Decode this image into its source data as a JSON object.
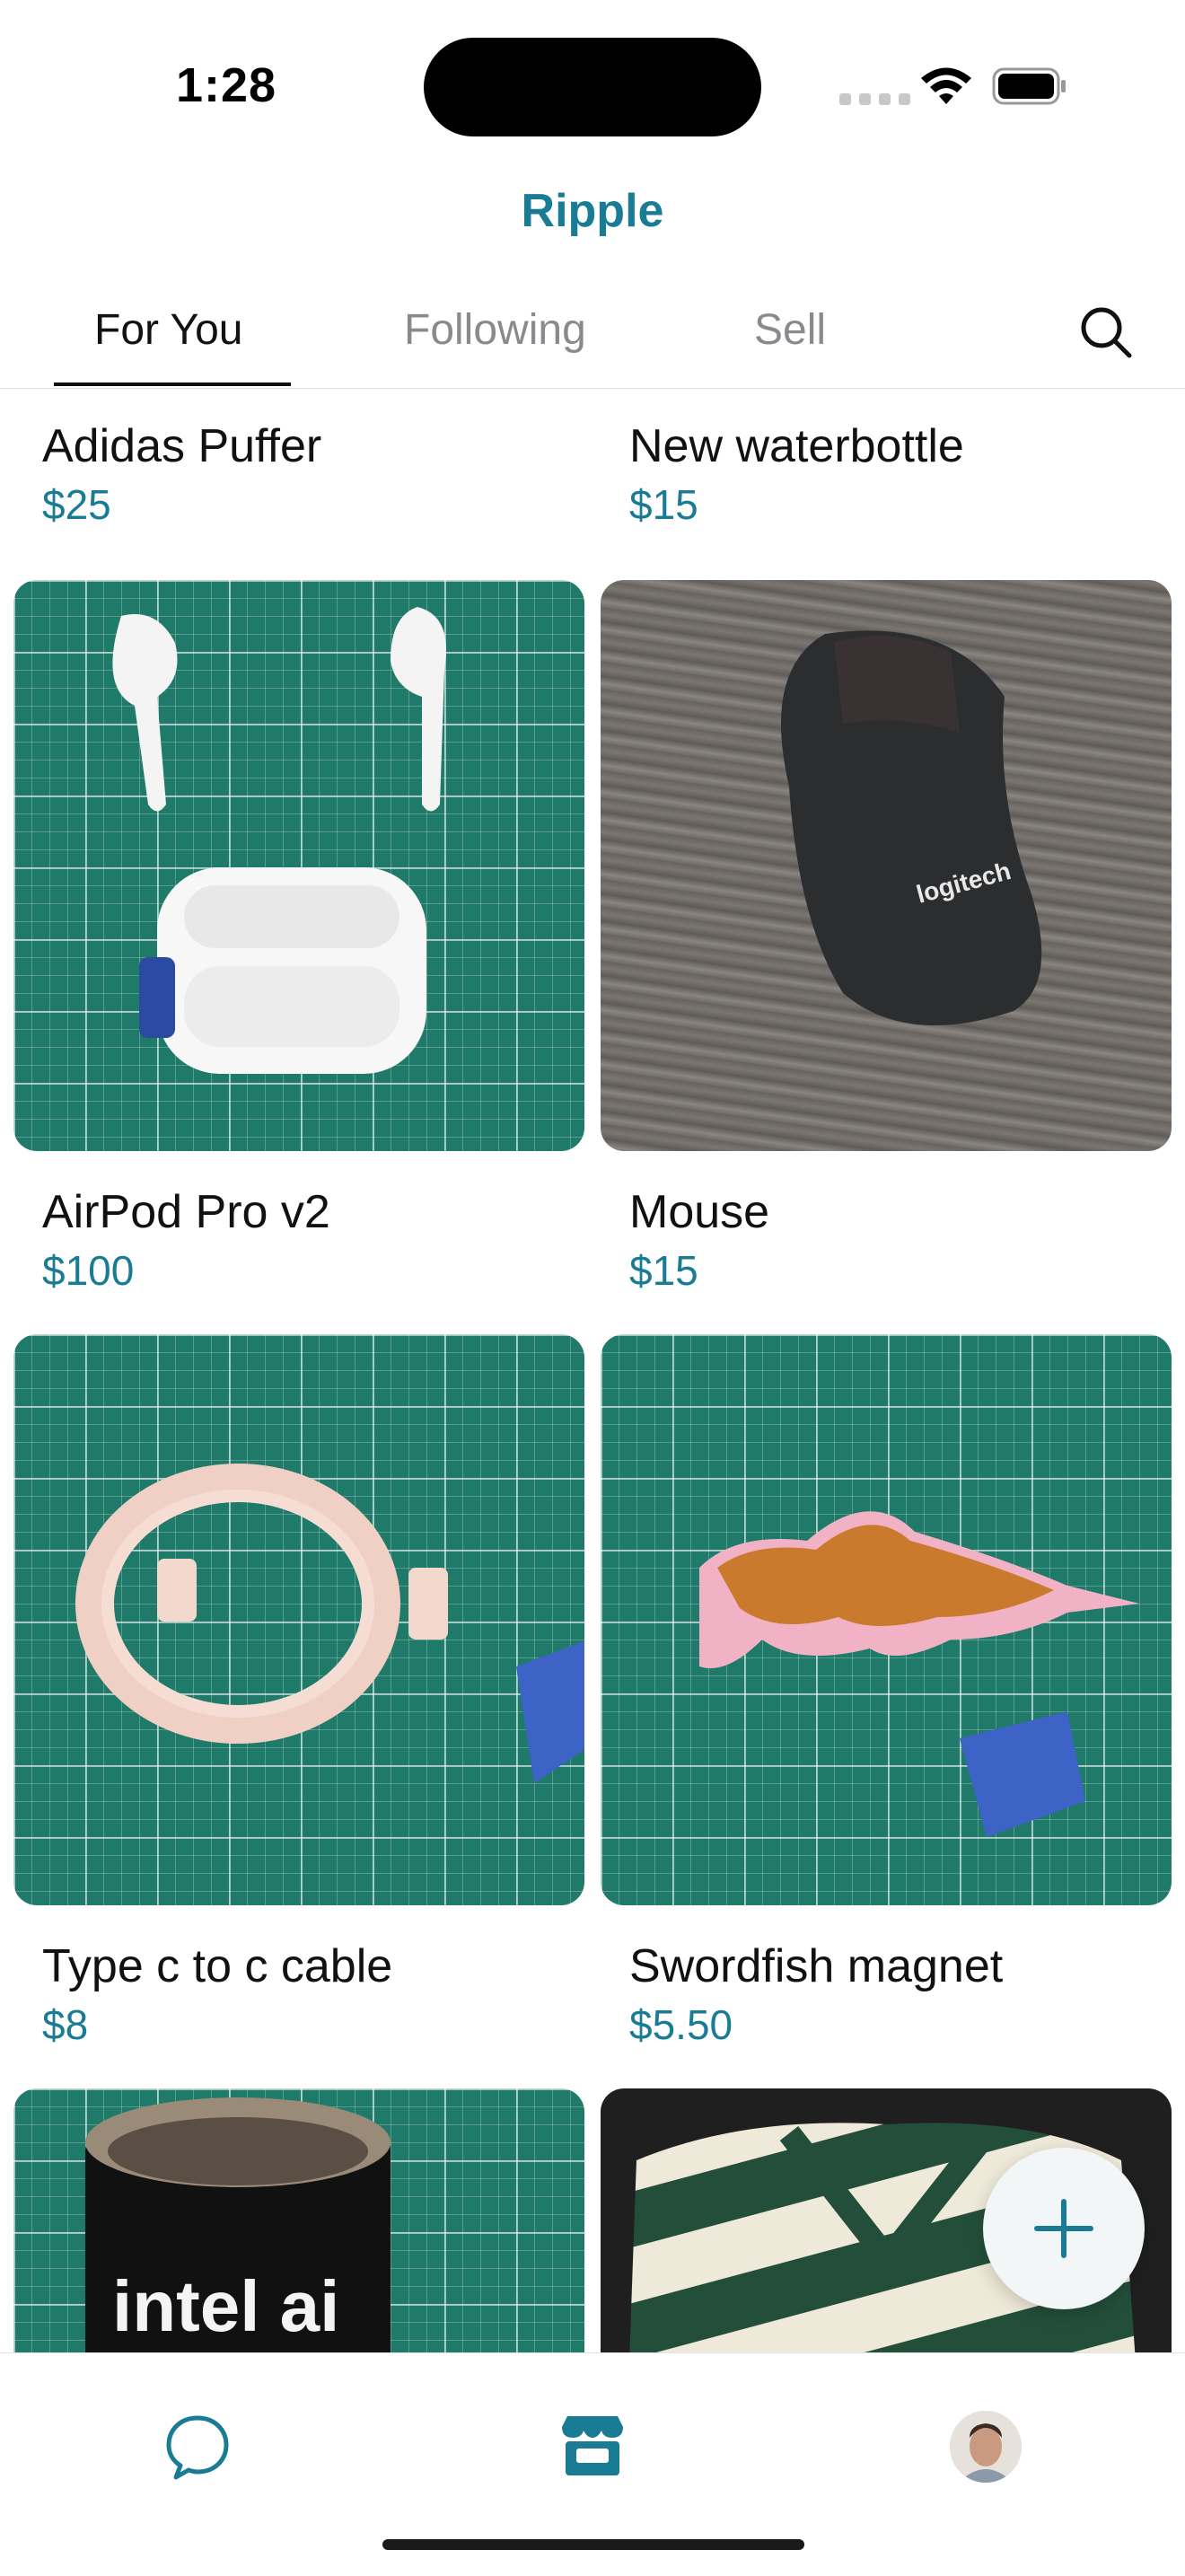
{
  "status_bar": {
    "time": "1:28"
  },
  "header": {
    "title": "Ripple"
  },
  "tabs": [
    {
      "label": "For You",
      "active": true
    },
    {
      "label": "Following",
      "active": false
    },
    {
      "label": "Sell",
      "active": false
    }
  ],
  "listings": [
    {
      "name": "Adidas Puffer",
      "price": "$25"
    },
    {
      "name": "New waterbottle",
      "price": "$15"
    },
    {
      "name": "AirPod Pro v2",
      "price": "$100"
    },
    {
      "name": "Mouse",
      "price": "$15"
    },
    {
      "name": "Type c to c cable",
      "price": "$8"
    },
    {
      "name": "Swordfish magnet",
      "price": "$5.50"
    },
    {
      "name": "",
      "price": ""
    },
    {
      "name": "",
      "price": ""
    }
  ],
  "fab_icon": "plus-icon",
  "bottom_nav": [
    {
      "icon": "chat-bubble-icon"
    },
    {
      "icon": "storefront-icon",
      "active": true
    },
    {
      "icon": "profile-avatar"
    }
  ],
  "colors": {
    "accent": "#1a7c94",
    "inactive_tab": "#8a8a8e"
  },
  "image_text": {
    "mouse_brand": "logitech",
    "mug_brand": "intel ai"
  }
}
